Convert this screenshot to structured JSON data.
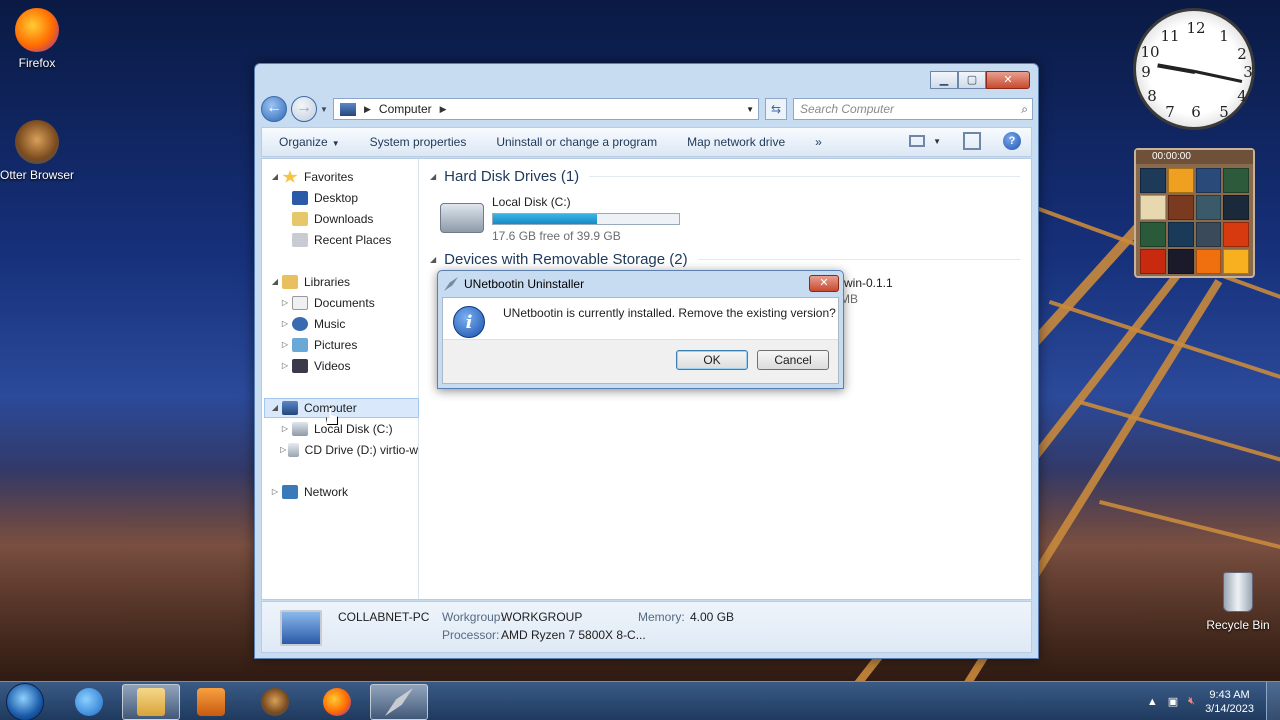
{
  "desktop": {
    "icons": [
      {
        "label": "Firefox"
      },
      {
        "label": "Otter Browser"
      },
      {
        "label": "Recycle Bin"
      }
    ]
  },
  "explorer": {
    "address": {
      "path": "Computer"
    },
    "search": {
      "placeholder": "Search Computer"
    },
    "toolbar": {
      "organize": "Organize",
      "system_properties": "System properties",
      "uninstall": "Uninstall or change a program",
      "map_drive": "Map network drive",
      "more": "»",
      "help": "?"
    },
    "nav": {
      "favorites": "Favorites",
      "desktop": "Desktop",
      "downloads": "Downloads",
      "recent_places": "Recent Places",
      "libraries": "Libraries",
      "documents": "Documents",
      "music": "Music",
      "pictures": "Pictures",
      "videos": "Videos",
      "computer": "Computer",
      "local_disk": "Local Disk (C:)",
      "cd_drive": "CD Drive (D:) virtio-w",
      "network": "Network"
    },
    "content": {
      "hdd_header": "Hard Disk Drives (1)",
      "drive_name": "Local Disk (C:)",
      "drive_free": "17.6 GB free of 39.9 GB",
      "drive_used_fraction": 0.56,
      "removable_header": "Devices with Removable Storage (2)",
      "removable_partial_name": "-win-0.1.1",
      "removable_partial_size": "MB"
    },
    "details": {
      "computer_name": "COLLABNET-PC",
      "workgroup_label": "Workgroup:",
      "workgroup": "WORKGROUP",
      "memory_label": "Memory:",
      "memory": "4.00 GB",
      "processor_label": "Processor:",
      "processor": "AMD Ryzen 7 5800X 8-C..."
    }
  },
  "dialog": {
    "title": "UNetbootin Uninstaller",
    "message": "UNetbootin is currently installed. Remove the existing version?",
    "ok": "OK",
    "cancel": "Cancel"
  },
  "gadgets": {
    "puzzle_timer": "00:00:00"
  },
  "taskbar": {
    "time": "9:43 AM",
    "date": "3/14/2023"
  }
}
